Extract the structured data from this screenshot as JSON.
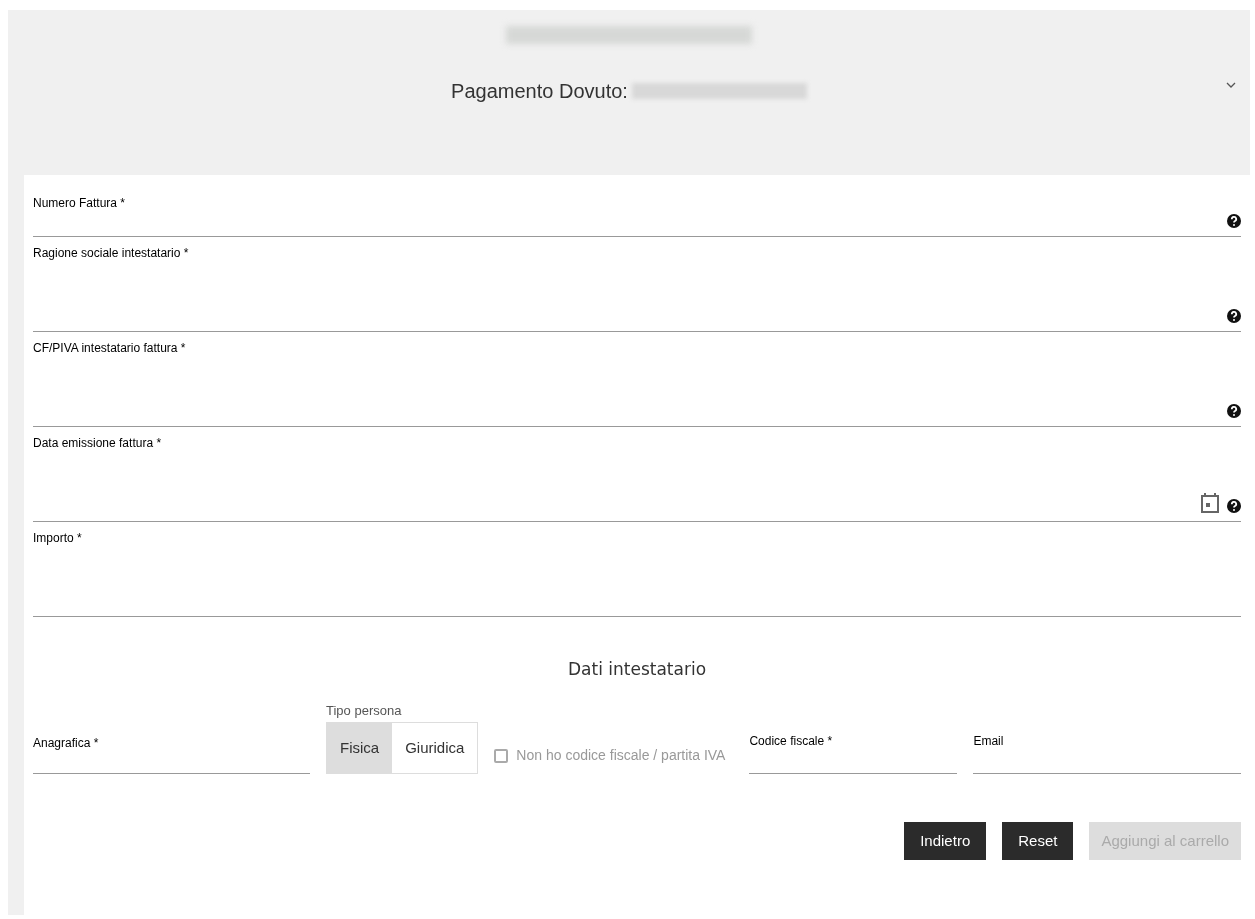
{
  "header": {
    "title": "Pagamento Dovuto:",
    "expanded": true
  },
  "fields": [
    {
      "label": "Numero Fattura *",
      "help": true,
      "calendar": false
    },
    {
      "label": "Ragione sociale intestatario *",
      "help": true,
      "calendar": false
    },
    {
      "label": "CF/PIVA intestatario fattura *",
      "help": true,
      "calendar": false
    },
    {
      "label": "Data emissione fattura *",
      "help": true,
      "calendar": true
    },
    {
      "label": "Importo *",
      "help": false,
      "calendar": false
    }
  ],
  "section_title": "Dati intestatario",
  "holder": {
    "anagrafica": {
      "label": "Anagrafica *"
    },
    "tipo_persona": {
      "label": "Tipo persona",
      "options": [
        {
          "label": "Fisica",
          "selected": true
        },
        {
          "label": "Giuridica",
          "selected": false
        }
      ]
    },
    "no_cf": {
      "label": "Non ho codice fiscale / partita IVA",
      "checked": false
    },
    "codice_fiscale": {
      "label": "Codice fiscale *"
    },
    "email": {
      "label": "Email"
    }
  },
  "buttons": [
    {
      "label": "Indietro",
      "disabled": false
    },
    {
      "label": "Reset",
      "disabled": false
    },
    {
      "label": "Aggiungi al carrello",
      "disabled": true
    }
  ]
}
